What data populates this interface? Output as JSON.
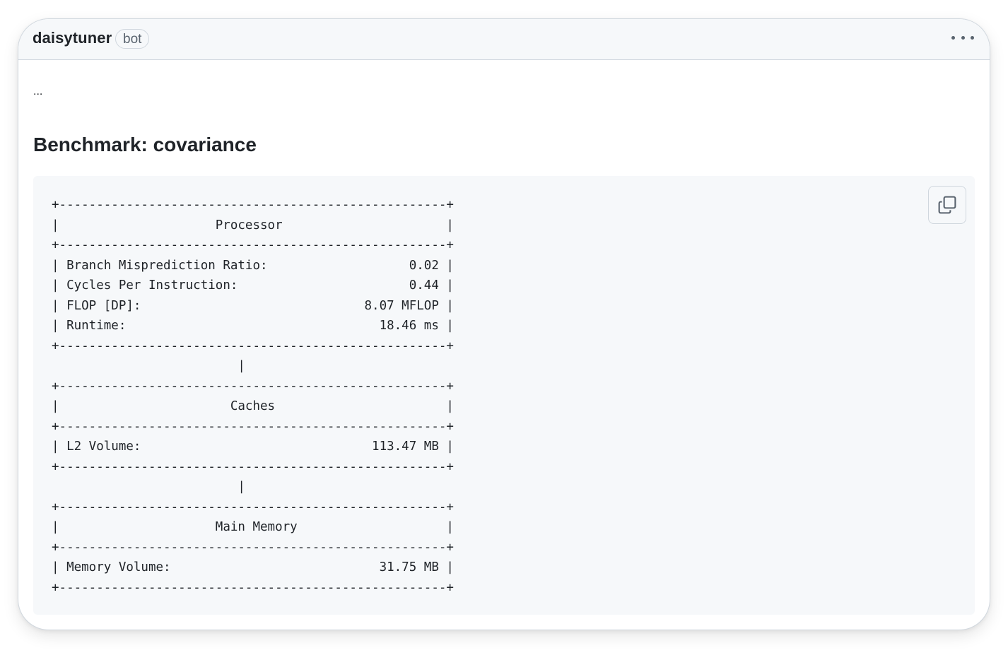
{
  "comment": {
    "author": "daisytuner",
    "badge": "bot",
    "menu_icon": "kebab-horizontal-icon",
    "ellipsis": "...",
    "heading": "Benchmark: covariance"
  },
  "code": {
    "copy_icon": "copy-icon",
    "lines": [
      "+----------------------------------------------------+",
      "|                     Processor                      |",
      "+----------------------------------------------------+",
      "| Branch Misprediction Ratio:                   0.02 |",
      "| Cycles Per Instruction:                       0.44 |",
      "| FLOP [DP]:                              8.07 MFLOP |",
      "| Runtime:                                  18.46 ms |",
      "+----------------------------------------------------+",
      "                         |",
      "+----------------------------------------------------+",
      "|                       Caches                       |",
      "+----------------------------------------------------+",
      "| L2 Volume:                               113.47 MB |",
      "+----------------------------------------------------+",
      "                         |",
      "+----------------------------------------------------+",
      "|                     Main Memory                    |",
      "+----------------------------------------------------+",
      "| Memory Volume:                            31.75 MB |",
      "+----------------------------------------------------+"
    ]
  }
}
